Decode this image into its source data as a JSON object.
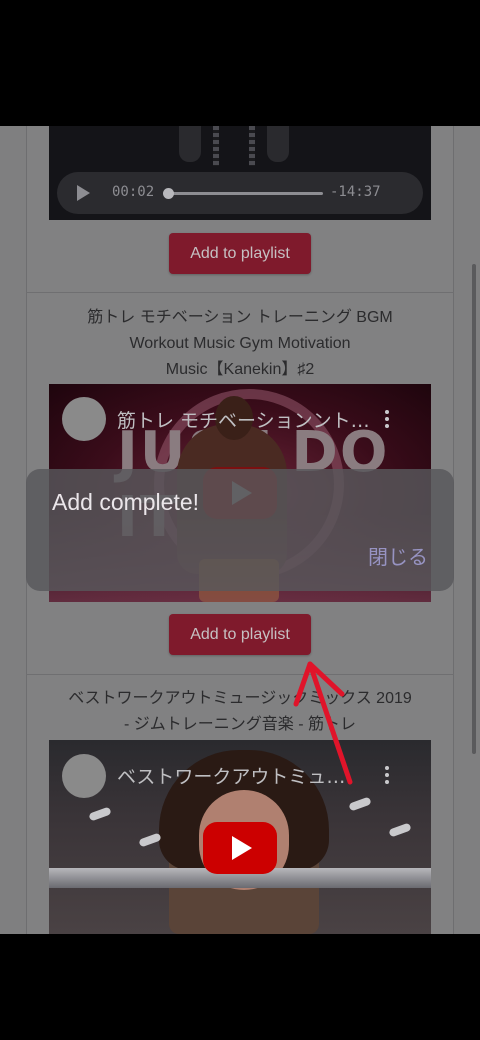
{
  "feed": {
    "items": [
      {
        "player": {
          "current_time": "00:02",
          "remaining_time": "-14:37",
          "progress_fraction": 0.01
        },
        "add_button_label": "Add to playlist"
      },
      {
        "title": "筋トレ モチベーション トレーニング BGM Workout Music Gym Motivation Music【Kanekin】♯2",
        "title_lines": [
          "筋トレ モチベーション トレーニング BGM",
          "Workout Music Gym Motivation",
          "Music【Kanekin】♯2"
        ],
        "video": {
          "channel_title": "筋トレ モチベーションント…",
          "thumbnail_text": "JUST DO IT."
        },
        "add_button_label": "Add to playlist"
      },
      {
        "title": "ベストワークアウトミュージックミックス 2019 - ジムトレーニング音楽 - 筋トレ",
        "title_lines": [
          "ベストワークアウトミュージックミックス 2019",
          "- ジムトレーニング音楽 - 筋トレ"
        ],
        "video": {
          "channel_title": "ベストワークアウトミュ…"
        }
      }
    ]
  },
  "toast": {
    "message": "Add complete!",
    "close_label": "閉じる"
  },
  "colors": {
    "button": "#7f1a2c",
    "youtube_red": "#cc0000",
    "arrow": "#e0142a",
    "toast_close": "#9793c2"
  },
  "icons": {
    "play": "play-icon",
    "more": "more-vert-icon",
    "youtube_play": "youtube-play-icon",
    "annotation": "red-arrow"
  }
}
